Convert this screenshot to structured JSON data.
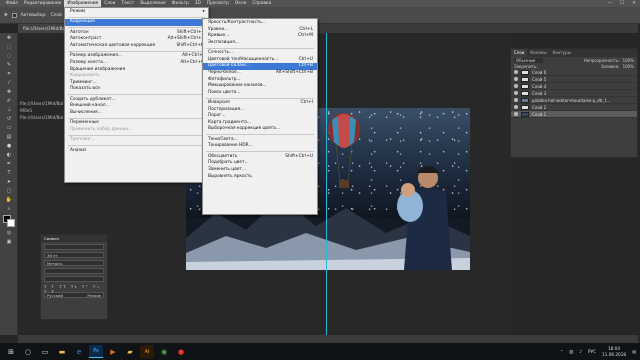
{
  "menubar": {
    "items": [
      "Файл",
      "Редактирование",
      "Изображение",
      "Слои",
      "Текст",
      "Выделение",
      "Фильтр",
      "3D",
      "Просмотр",
      "Окно",
      "Справка"
    ],
    "active_index": 2
  },
  "window_controls": [
    "—",
    "☐",
    "✕"
  ],
  "optionsbar": {
    "autoselect_label": "Автовыбор:",
    "autoselect_value": "Слой",
    "transform_label": "Показ. упр. элем."
  },
  "document": {
    "tab_title": "file:///Users/1Mid/Bal..."
  },
  "canvas": {
    "info_lines": [
      "file:///Users/1Mid/Bal",
      "9f0e5",
      "file:///Users/1Mid/Bal"
    ]
  },
  "menu_image": {
    "items": [
      {
        "label": "Режим",
        "shortcut": "",
        "submenu": true,
        "disabled": false
      },
      {
        "sep": true
      },
      {
        "label": "Коррекция",
        "shortcut": "",
        "submenu": true,
        "highlight": true
      },
      {
        "sep": true
      },
      {
        "label": "Автотон",
        "shortcut": "Shift+Ctrl+L"
      },
      {
        "label": "Автоконтраст",
        "shortcut": "Alt+Shift+Ctrl+L"
      },
      {
        "label": "Автоматическая цветовая коррекция",
        "shortcut": "Shift+Ctrl+B"
      },
      {
        "sep": true
      },
      {
        "label": "Размер изображения...",
        "shortcut": "Alt+Ctrl+I"
      },
      {
        "label": "Размер холста...",
        "shortcut": "Alt+Ctrl+C"
      },
      {
        "label": "Вращение изображения",
        "shortcut": "",
        "submenu": true
      },
      {
        "label": "Кадрировать",
        "disabled": true
      },
      {
        "label": "Тримминг..."
      },
      {
        "label": "Показать все"
      },
      {
        "sep": true
      },
      {
        "label": "Создать дубликат..."
      },
      {
        "label": "Внешний канал..."
      },
      {
        "label": "Вычисления..."
      },
      {
        "sep": true
      },
      {
        "label": "Переменные",
        "submenu": true
      },
      {
        "label": "Применить набор данных...",
        "disabled": true
      },
      {
        "sep": true
      },
      {
        "label": "Треппинг...",
        "disabled": true
      },
      {
        "sep": true
      },
      {
        "label": "Анализ",
        "submenu": true
      }
    ]
  },
  "menu_correction": {
    "items": [
      {
        "label": "Яркость/Контрастность..."
      },
      {
        "label": "Уровни...",
        "shortcut": "Ctrl+L"
      },
      {
        "label": "Кривые...",
        "shortcut": "Ctrl+M"
      },
      {
        "label": "Экспозиция..."
      },
      {
        "sep": true
      },
      {
        "label": "Сочность..."
      },
      {
        "label": "Цветовой тон/Насыщенность...",
        "shortcut": "Ctrl+U"
      },
      {
        "label": "Цветовой баланс...",
        "shortcut": "Ctrl+B",
        "highlight": true
      },
      {
        "label": "Черно-белое...",
        "shortcut": "Alt+Shift+Ctrl+B"
      },
      {
        "label": "Фотофильтр..."
      },
      {
        "label": "Микширование каналов..."
      },
      {
        "label": "Поиск цвета..."
      },
      {
        "sep": true
      },
      {
        "label": "Инверсия",
        "shortcut": "Ctrl+I"
      },
      {
        "label": "Постеризация..."
      },
      {
        "label": "Порог..."
      },
      {
        "label": "Карта градиента..."
      },
      {
        "label": "Выборочная коррекция цвета..."
      },
      {
        "sep": true
      },
      {
        "label": "Тени/Света..."
      },
      {
        "label": "Тонирование HDR..."
      },
      {
        "sep": true
      },
      {
        "label": "Обесцветить",
        "shortcut": "Shift+Ctrl+U"
      },
      {
        "label": "Подобрать цвет..."
      },
      {
        "label": "Заменить цвет..."
      },
      {
        "label": "Выровнять яркость"
      }
    ]
  },
  "layers_panel": {
    "tabs": [
      "Слои",
      "Каналы",
      "Контуры"
    ],
    "mode": "Обычные",
    "opacity_label": "Непрозрачность:",
    "opacity": "100%",
    "lock_label": "Закрепить:",
    "fill_label": "Заливка:",
    "fill": "100%",
    "layers": [
      "Слой 6",
      "Слой 5",
      "Слой 4",
      "Слой 3",
      "palatka-hot-winter-mountains-p_dtr_t...",
      "Слой 2",
      "Слой 1"
    ],
    "selected_index": 6
  },
  "char_panel": {
    "title": "Символ",
    "size": "36 пт",
    "kerning": "Метрич.",
    "lang": "Русский",
    "aa": "Резкое"
  },
  "taskbar": {
    "icons": [
      "windows-icon",
      "search-icon",
      "task-view-icon",
      "file-explorer-icon",
      "edge-icon",
      "photoshop-icon",
      "media-player-icon",
      "folder-icon",
      "illustrator-icon",
      "chrome-icon",
      "record-icon"
    ],
    "lang": "РУС",
    "time": "18:04",
    "date": "11.06.2018"
  },
  "colors": {
    "highlight": "#3c79d6",
    "guide": "#2bb5d6",
    "panel": "#3e3e3e"
  }
}
